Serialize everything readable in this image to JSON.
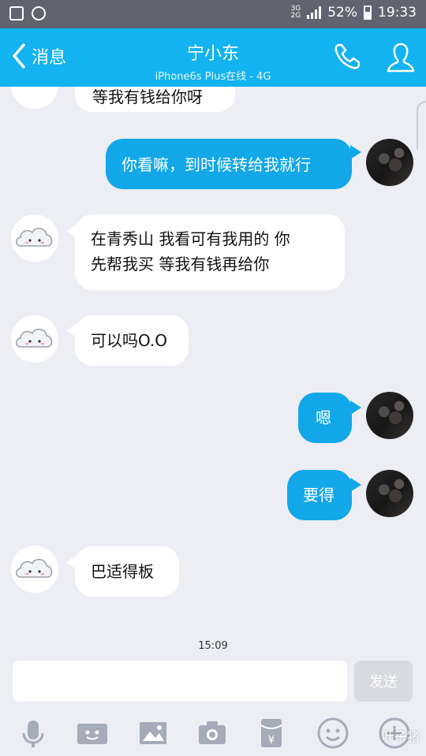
{
  "status_bar": {
    "network_top": "3G",
    "network_bottom": "2G",
    "battery": "52%",
    "time": "19:33"
  },
  "header": {
    "back_label": "消息",
    "title": "宁小东",
    "subtitle": "iPhone6s Plus在线 - 4G"
  },
  "messages": [
    {
      "side": "left",
      "text": "等我有钱给你呀"
    },
    {
      "side": "right",
      "text": "你看嘛，到时候转给我就行"
    },
    {
      "side": "left",
      "line1": "在青秀山 我看可有我用的 你",
      "line2": "先帮我买 等我有钱再给你"
    },
    {
      "side": "left",
      "text": "可以吗O.O"
    },
    {
      "side": "right",
      "text": "嗯"
    },
    {
      "side": "right",
      "text": "要得"
    },
    {
      "side": "left",
      "text": "巴适得板"
    }
  ],
  "timestamp": "15:09",
  "composer": {
    "input_value": "",
    "send_label": "发送"
  },
  "toolbar": [
    "microphone-icon",
    "video-icon",
    "image-icon",
    "camera-icon",
    "red-packet-icon",
    "emoji-icon",
    "plus-icon"
  ],
  "watermark": "叶子猪",
  "colors": {
    "header": "#12b3f0",
    "bubble_right": "#12a7e8",
    "background": "#eceef4"
  }
}
